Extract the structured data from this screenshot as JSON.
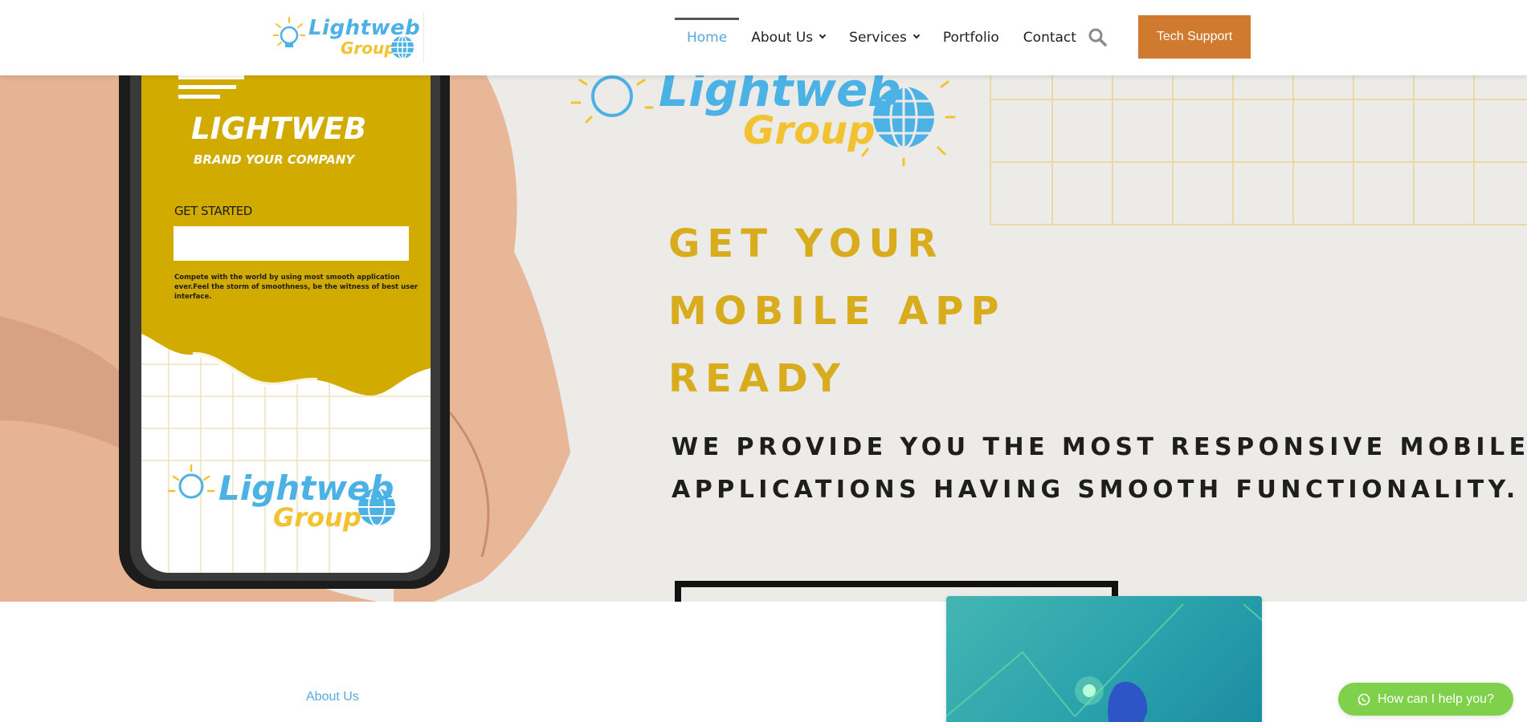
{
  "header": {
    "logo": {
      "word1": "Lightweb",
      "word2": "Group"
    },
    "nav": [
      {
        "label": "Home"
      },
      {
        "label": "About Us"
      },
      {
        "label": "Services"
      },
      {
        "label": "Portfolio"
      },
      {
        "label": "Contact"
      }
    ],
    "cta_label": "Tech Support"
  },
  "hero": {
    "logo": {
      "word1": "Lightweb",
      "word2": "Group"
    },
    "headline": [
      "GET YOUR",
      "MOBILE APP",
      "READY"
    ],
    "subline": [
      "WE PROVIDE YOU THE MOST RESPONSIVE MOBILE",
      "APPLICATIONS HAVING SMOOTH FUNCTIONALITY."
    ],
    "phone": {
      "brand": "LIGHTWEB",
      "tagline": "BRAND YOUR COMPANY",
      "get_started": "GET STARTED",
      "body": "Compete with the world by using most smooth application ever.Feel the storm of smoothness, be the witness of best user interface.",
      "logo_word1": "Lightweb",
      "logo_word2": "Group"
    }
  },
  "about": {
    "label": "About Us"
  },
  "chat": {
    "label": "How can I help you?"
  },
  "colors": {
    "accent_blue": "#5aa7dd",
    "cta_orange": "#cf7a2e",
    "headline_gold": "#d8ac1c",
    "phone_yellow": "#d2ab00",
    "chat_green": "#7fd04b",
    "card_teal": "#2aa2ac"
  }
}
